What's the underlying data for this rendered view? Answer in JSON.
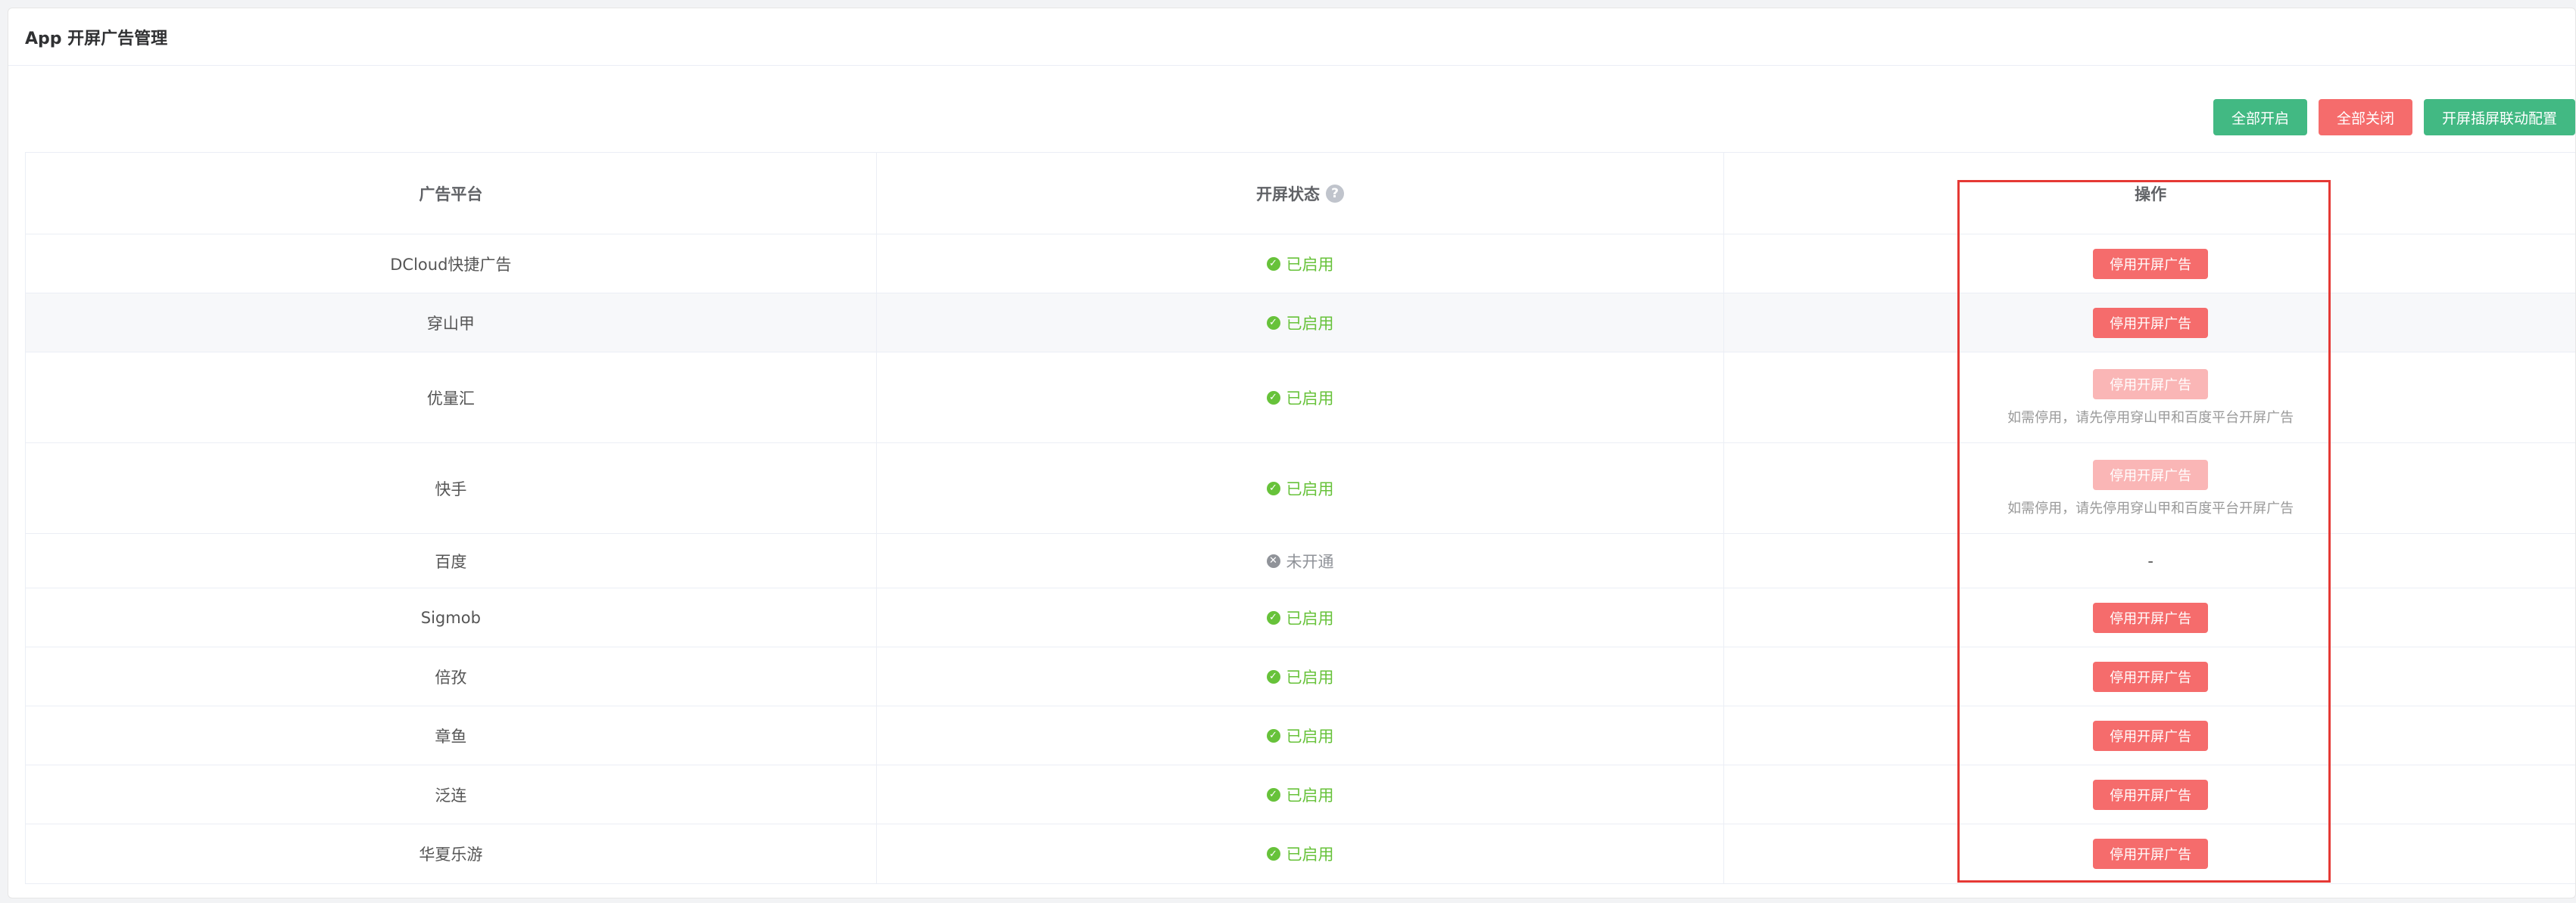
{
  "header": {
    "title": "App 开屏广告管理"
  },
  "toolbar": {
    "enable_all": "全部开启",
    "disable_all": "全部关闭",
    "linkage_config": "开屏插屏联动配置"
  },
  "table": {
    "columns": {
      "platform": "广告平台",
      "status": "开屏状态",
      "action": "操作"
    },
    "help_icon": "question-circle-icon",
    "rows": [
      {
        "platform": "DCloud快捷广告",
        "status": "已启用",
        "action": "停用开屏广告",
        "note": ""
      },
      {
        "platform": "穿山甲",
        "status": "已启用",
        "action": "停用开屏广告",
        "note": ""
      },
      {
        "platform": "优量汇",
        "status": "已启用",
        "action": "停用开屏广告",
        "note": "如需停用，请先停用穿山甲和百度平台开屏广告"
      },
      {
        "platform": "快手",
        "status": "已启用",
        "action": "停用开屏广告",
        "note": "如需停用，请先停用穿山甲和百度平台开屏广告"
      },
      {
        "platform": "百度",
        "status": "未开通",
        "action": "-",
        "note": ""
      },
      {
        "platform": "Sigmob",
        "status": "已启用",
        "action": "停用开屏广告",
        "note": ""
      },
      {
        "platform": "倍孜",
        "status": "已启用",
        "action": "停用开屏广告",
        "note": ""
      },
      {
        "platform": "章鱼",
        "status": "已启用",
        "action": "停用开屏广告",
        "note": ""
      },
      {
        "platform": "泛连",
        "status": "已启用",
        "action": "停用开屏广告",
        "note": ""
      },
      {
        "platform": "华夏乐游",
        "status": "已启用",
        "action": "停用开屏广告",
        "note": ""
      }
    ]
  },
  "colors": {
    "primary_green": "#42b983",
    "danger_red": "#f56c6c",
    "danger_red_disabled": "#fab6b6",
    "success_text": "#67c23a",
    "highlight_border": "#e53935"
  }
}
